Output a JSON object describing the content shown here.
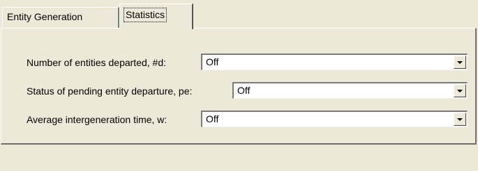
{
  "tabs": {
    "entity_generation": "Entity Generation",
    "statistics": "Statistics"
  },
  "rows": [
    {
      "label": "Number of entities departed, #d:",
      "value": "Off"
    },
    {
      "label": "Status of pending entity departure, pe:",
      "value": "Off"
    },
    {
      "label": "Average intergeneration time, w:",
      "value": "Off"
    }
  ],
  "icons": {
    "dropdown": "chevron-down-icon"
  },
  "colors": {
    "background": "#ece9d8",
    "field": "#ffffff"
  }
}
